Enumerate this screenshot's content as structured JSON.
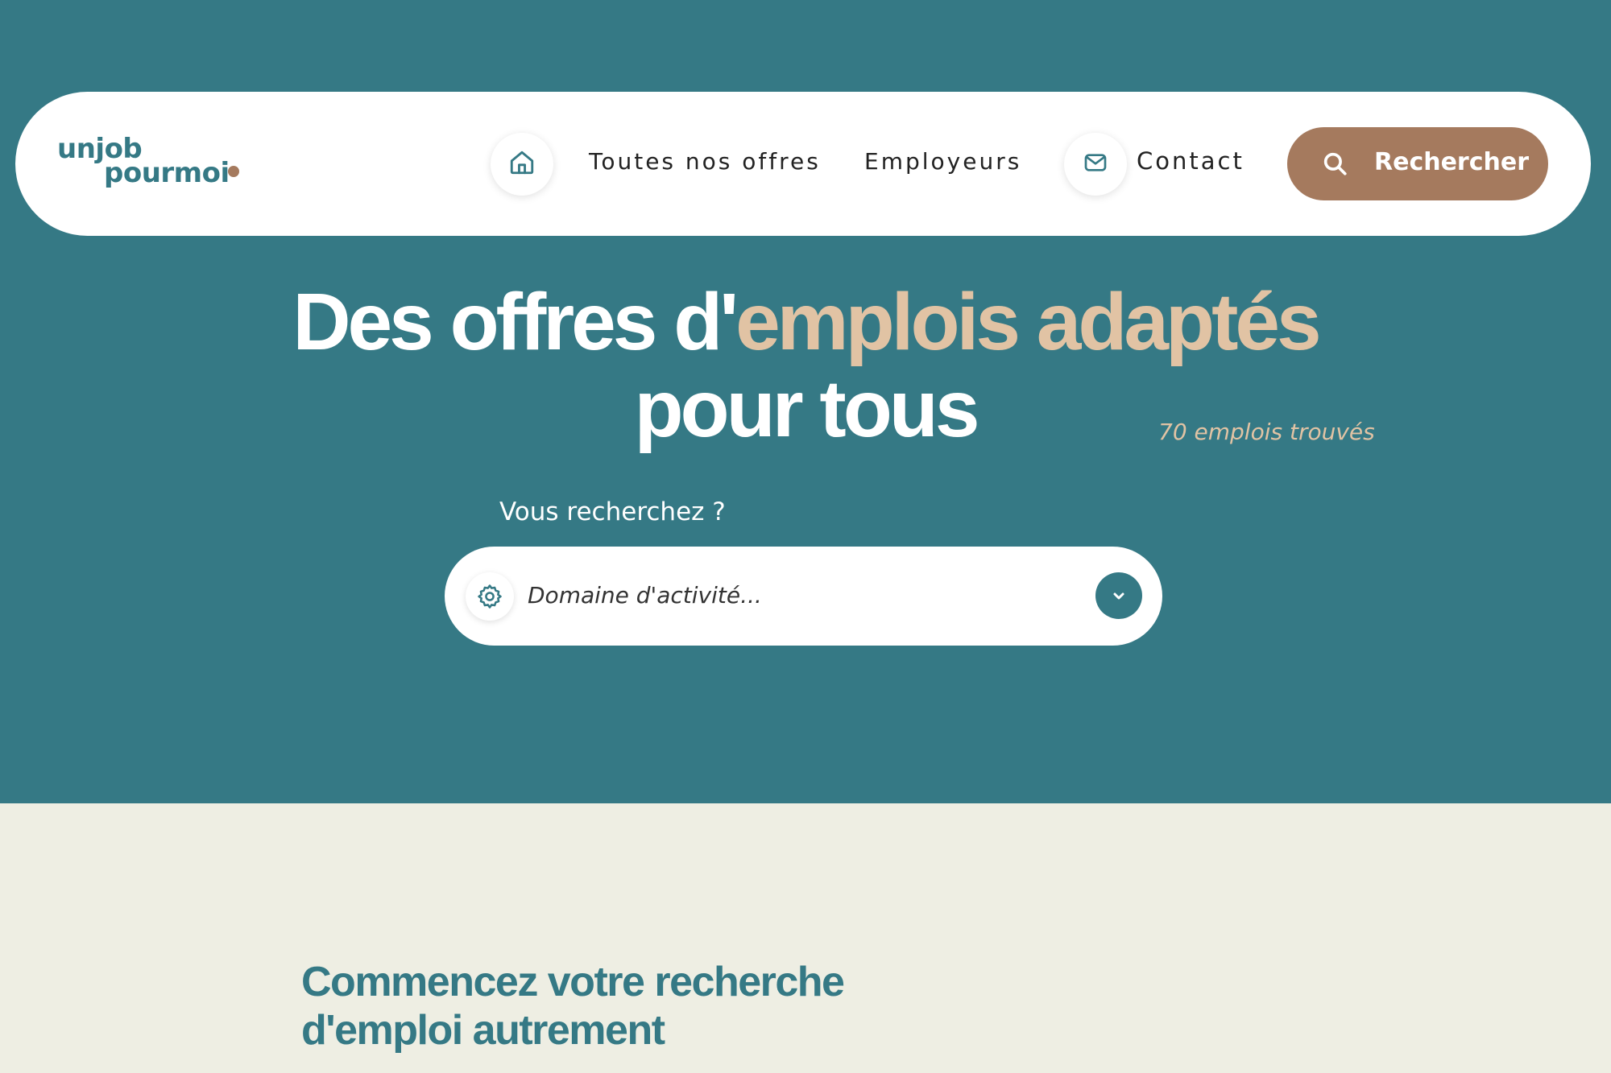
{
  "brand": {
    "logo_line1": "unjob",
    "logo_line2": "pourmoi",
    "primary_color": "#357985",
    "accent_color": "#a57a5e",
    "highlight_color": "#e1c3a4",
    "background_light": "#eeeee3"
  },
  "nav": {
    "home_icon": "home-icon",
    "offers_label": "Toutes nos offres",
    "employers_label": "Employeurs",
    "contact_icon": "mail-icon",
    "contact_label": "Contact",
    "search_icon": "search-icon",
    "search_label": "Rechercher"
  },
  "hero": {
    "title_part1": "Des offres d'",
    "title_accent": "emplois adaptés",
    "title_part2": "pour tous",
    "jobs_count": "70 emplois trouvés",
    "search_label": "Vous recherchez ?",
    "domain_placeholder": "Domaine d'activité...",
    "domain_icon": "gear-icon",
    "dropdown_icon": "chevron-down-icon"
  },
  "section": {
    "title_line1": "Commencez votre recherche",
    "title_line2": "d'emploi autrement"
  }
}
